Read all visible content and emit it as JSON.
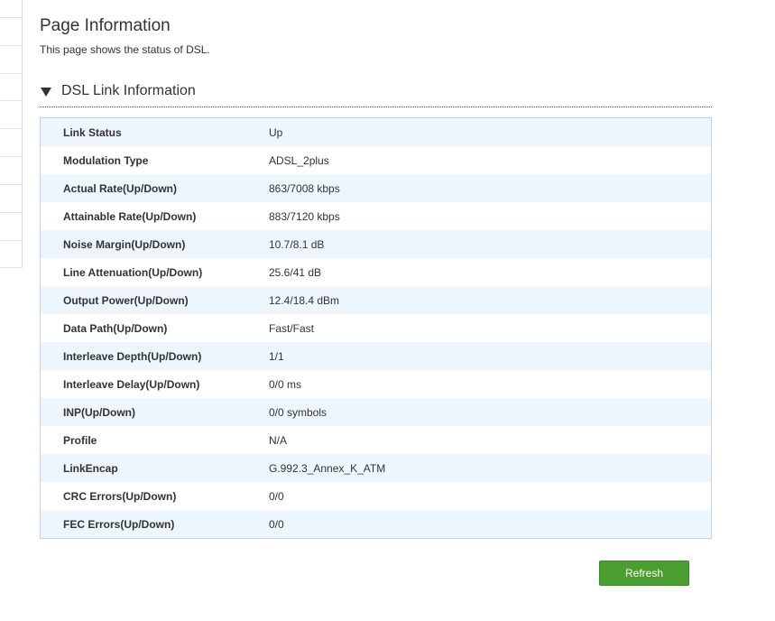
{
  "page": {
    "title": "Page Information",
    "description": "This page shows the status of DSL."
  },
  "section": {
    "title": "DSL Link Information",
    "expanded": true
  },
  "rows": [
    {
      "label": "Link Status",
      "value": "Up"
    },
    {
      "label": "Modulation Type",
      "value": "ADSL_2plus"
    },
    {
      "label": "Actual Rate(Up/Down)",
      "value": "863/7008 kbps"
    },
    {
      "label": "Attainable Rate(Up/Down)",
      "value": "883/7120 kbps"
    },
    {
      "label": "Noise Margin(Up/Down)",
      "value": "10.7/8.1 dB"
    },
    {
      "label": "Line Attenuation(Up/Down)",
      "value": "25.6/41 dB"
    },
    {
      "label": "Output Power(Up/Down)",
      "value": "12.4/18.4 dBm"
    },
    {
      "label": "Data Path(Up/Down)",
      "value": "Fast/Fast"
    },
    {
      "label": "Interleave Depth(Up/Down)",
      "value": "1/1"
    },
    {
      "label": "Interleave Delay(Up/Down)",
      "value": "0/0 ms"
    },
    {
      "label": "INP(Up/Down)",
      "value": "0/0 symbols"
    },
    {
      "label": "Profile",
      "value": "N/A"
    },
    {
      "label": "LinkEncap",
      "value": "G.992.3_Annex_K_ATM"
    },
    {
      "label": "CRC Errors(Up/Down)",
      "value": "0/0"
    },
    {
      "label": "FEC Errors(Up/Down)",
      "value": "0/0"
    }
  ],
  "actions": {
    "refresh_label": "Refresh"
  },
  "colors": {
    "row_stripe": "#eef6fd",
    "table_border": "#c8d3dc",
    "button_bg": "#4a9d2f"
  },
  "icons": {
    "section_toggle": "caret-down-icon"
  }
}
